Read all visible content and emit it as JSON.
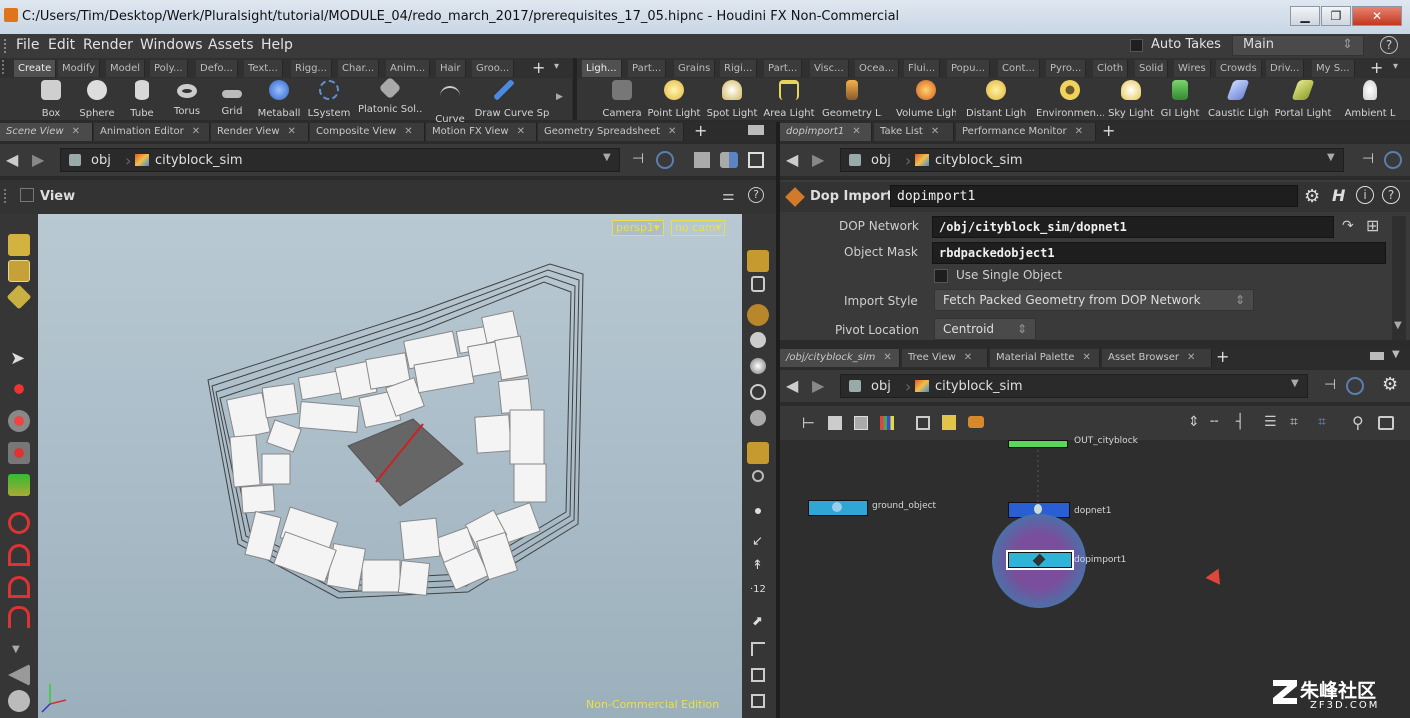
{
  "window": {
    "title": "C:/Users/Tim/Desktop/Werk/Pluralsight/tutorial/MODULE_04/redo_march_2017/prerequisites_17_05.hipnc - Houdini FX Non-Commercial",
    "min": "▁",
    "max": "❐",
    "close": "✕"
  },
  "menu": [
    "File",
    "Edit",
    "Render",
    "Windows",
    "Assets",
    "Help"
  ],
  "auto_takes": "Auto Takes",
  "desktop": "Main",
  "help": "?",
  "shelf_tabs_left": [
    "Create",
    "Modify",
    "Model",
    "Poly...",
    "Defo...",
    "Text...",
    "Rigg...",
    "Char...",
    "Anim...",
    "Hair",
    "Groo..."
  ],
  "shelf_tabs_right": [
    "Ligh...",
    "Part...",
    "Grains",
    "Rigi...",
    "Part...",
    "Visc...",
    "Ocea...",
    "Flui...",
    "Popu...",
    "Cont...",
    "Pyro...",
    "Cloth",
    "Solid",
    "Wires",
    "Crowds",
    "Driv...",
    "My S..."
  ],
  "tools_left": [
    "Box",
    "Sphere",
    "Tube",
    "Torus",
    "Grid",
    "Metaball",
    "LSystem",
    "Platonic Sol...",
    "Curve",
    "Draw Curve",
    "Sp"
  ],
  "tools_right": [
    "Camera",
    "Point Light",
    "Spot Light",
    "Area Light",
    "Geometry L...",
    "Volume Light",
    "Distant Light",
    "Environmen...",
    "Sky Light",
    "GI Light",
    "Caustic Light",
    "Portal Light",
    "Ambient L"
  ],
  "pane_tabs_left": [
    "Scene View",
    "Animation Editor",
    "Render View",
    "Composite View",
    "Motion FX View",
    "Geometry Spreadsheet"
  ],
  "pane_tabs_topright": [
    "dopimport1",
    "Take List",
    "Performance Monitor"
  ],
  "pane_tabs_botright": [
    "/obj/cityblock_sim",
    "Tree View",
    "Material Palette",
    "Asset Browser"
  ],
  "path": {
    "root": "obj",
    "node": "cityblock_sim"
  },
  "view": {
    "label": "View",
    "persp": "persp1▾",
    "cam": "no cam▾",
    "edition": "Non-Commercial Edition"
  },
  "parms": {
    "optype": "Dop Import",
    "name": "dopimport1",
    "dop_network_label": "DOP Network",
    "dop_network": "/obj/cityblock_sim/dopnet1",
    "object_mask_label": "Object Mask",
    "object_mask": "rbdpackedobject1",
    "use_single": "Use Single Object",
    "import_style_label": "Import Style",
    "import_style": "Fetch Packed Geometry from DOP Network",
    "pivot_label": "Pivot Location",
    "pivot": "Centroid"
  },
  "nodes": {
    "top": "OUT_cityblock",
    "ground": "ground_object",
    "dopnet": "dopnet1",
    "dopimport": "dopimport1"
  },
  "watermark": {
    "brand": "朱峰社区",
    "site": "ZF3D.COM"
  }
}
